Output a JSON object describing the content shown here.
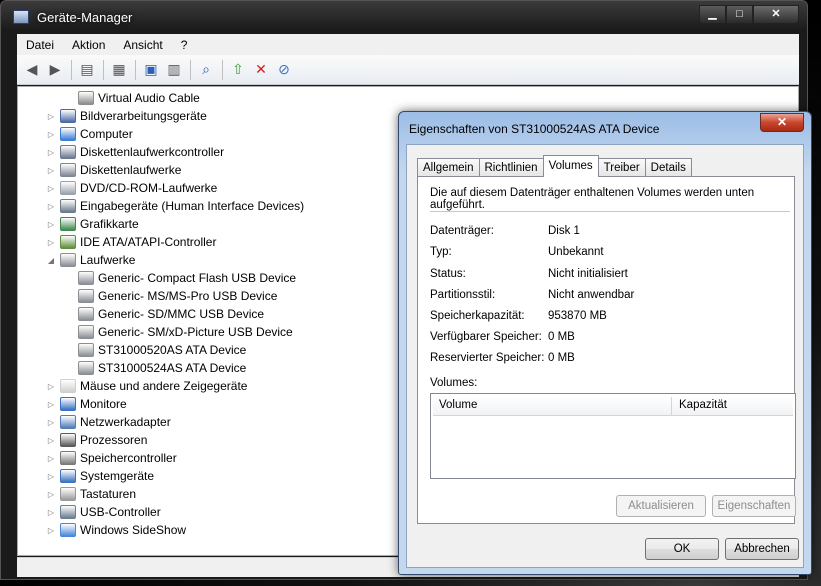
{
  "window": {
    "title": "Geräte-Manager"
  },
  "caption": {
    "minimize": "▁",
    "maximize": "□",
    "close": "✕"
  },
  "menu": [
    "Datei",
    "Aktion",
    "Ansicht",
    "?"
  ],
  "tree": [
    {
      "label": "Virtual Audio Cable",
      "level": 2,
      "icon": "speaker-icon",
      "color": "#8c8c8c",
      "expander": ""
    },
    {
      "label": "Bildverarbeitungsgeräte",
      "level": 1,
      "icon": "camera-icon",
      "color": "#4a6aa3",
      "expander": "▷"
    },
    {
      "label": "Computer",
      "level": 1,
      "icon": "computer-icon",
      "color": "#3a7bd5",
      "expander": "▷"
    },
    {
      "label": "Diskettenlaufwerkcontroller",
      "level": 1,
      "icon": "controller-icon",
      "color": "#6b7a8f",
      "expander": "▷"
    },
    {
      "label": "Diskettenlaufwerke",
      "level": 1,
      "icon": "floppy-icon",
      "color": "#7f8794",
      "expander": "▷"
    },
    {
      "label": "DVD/CD-ROM-Laufwerke",
      "level": 1,
      "icon": "dvd-icon",
      "color": "#9aa3ad",
      "expander": "▷"
    },
    {
      "label": "Eingabegeräte (Human Interface Devices)",
      "level": 1,
      "icon": "hid-icon",
      "color": "#6c7a89",
      "expander": "▷"
    },
    {
      "label": "Grafikkarte",
      "level": 1,
      "icon": "display-adapter-icon",
      "color": "#3d8a4e",
      "expander": "▷"
    },
    {
      "label": "IDE ATA/ATAPI-Controller",
      "level": 1,
      "icon": "ide-controller-icon",
      "color": "#5e8e3e",
      "expander": "▷"
    },
    {
      "label": "Laufwerke",
      "level": 1,
      "icon": "drive-icon",
      "color": "#8a8f96",
      "expander": "◢"
    },
    {
      "label": "Generic- Compact Flash USB Device",
      "level": 2,
      "icon": "drive-icon",
      "color": "#8a8f96",
      "expander": ""
    },
    {
      "label": "Generic- MS/MS-Pro USB Device",
      "level": 2,
      "icon": "drive-icon",
      "color": "#8a8f96",
      "expander": ""
    },
    {
      "label": "Generic- SD/MMC USB Device",
      "level": 2,
      "icon": "drive-icon",
      "color": "#8a8f96",
      "expander": ""
    },
    {
      "label": "Generic- SM/xD-Picture USB Device",
      "level": 2,
      "icon": "drive-icon",
      "color": "#8a8f96",
      "expander": ""
    },
    {
      "label": "ST31000520AS ATA Device",
      "level": 2,
      "icon": "drive-icon",
      "color": "#8a8f96",
      "expander": ""
    },
    {
      "label": "ST31000524AS ATA Device",
      "level": 2,
      "icon": "drive-icon",
      "color": "#8a8f96",
      "expander": ""
    },
    {
      "label": "Mäuse und andere Zeigegeräte",
      "level": 1,
      "icon": "mouse-icon",
      "color": "#cfcfcf",
      "expander": "▷"
    },
    {
      "label": "Monitore",
      "level": 1,
      "icon": "monitor-icon",
      "color": "#3a6fc4",
      "expander": "▷"
    },
    {
      "label": "Netzwerkadapter",
      "level": 1,
      "icon": "network-icon",
      "color": "#4f7db8",
      "expander": "▷"
    },
    {
      "label": "Prozessoren",
      "level": 1,
      "icon": "processor-icon",
      "color": "#5a5a5a",
      "expander": "▷"
    },
    {
      "label": "Speichercontroller",
      "level": 1,
      "icon": "storage-controller-icon",
      "color": "#7a7a7a",
      "expander": "▷"
    },
    {
      "label": "Systemgeräte",
      "level": 1,
      "icon": "system-devices-icon",
      "color": "#3c72c0",
      "expander": "▷"
    },
    {
      "label": "Tastaturen",
      "level": 1,
      "icon": "keyboard-icon",
      "color": "#9a9a9a",
      "expander": "▷"
    },
    {
      "label": "USB-Controller",
      "level": 1,
      "icon": "usb-icon",
      "color": "#6b7f92",
      "expander": "▷"
    },
    {
      "label": "Windows SideShow",
      "level": 1,
      "icon": "sideshow-icon",
      "color": "#4a86d8",
      "expander": "▷"
    }
  ],
  "dialog": {
    "title": "Eigenschaften von ST31000524AS ATA Device",
    "close": "✕",
    "tabs": [
      "Allgemein",
      "Richtlinien",
      "Volumes",
      "Treiber",
      "Details"
    ],
    "active_tab": "Volumes",
    "description": "Die auf diesem Datenträger enthaltenen Volumes werden unten aufgeführt.",
    "properties": [
      {
        "label": "Datenträger:",
        "value": "Disk 1"
      },
      {
        "label": "Typ:",
        "value": "Unbekannt"
      },
      {
        "label": "Status:",
        "value": "Nicht initialisiert"
      },
      {
        "label": "Partitionsstil:",
        "value": "Nicht anwendbar"
      },
      {
        "label": "Speicherkapazität:",
        "value": "953870 MB"
      },
      {
        "label": "Verfügbarer Speicher:",
        "value": "0 MB"
      },
      {
        "label": "Reservierter Speicher:",
        "value": "0 MB"
      }
    ],
    "volumes_label": "Volumes:",
    "volume_columns": [
      "Volume",
      "Kapazität"
    ],
    "refresh_button": "Aktualisieren",
    "properties_button": "Eigenschaften",
    "ok_button": "OK",
    "cancel_button": "Abbrechen"
  }
}
